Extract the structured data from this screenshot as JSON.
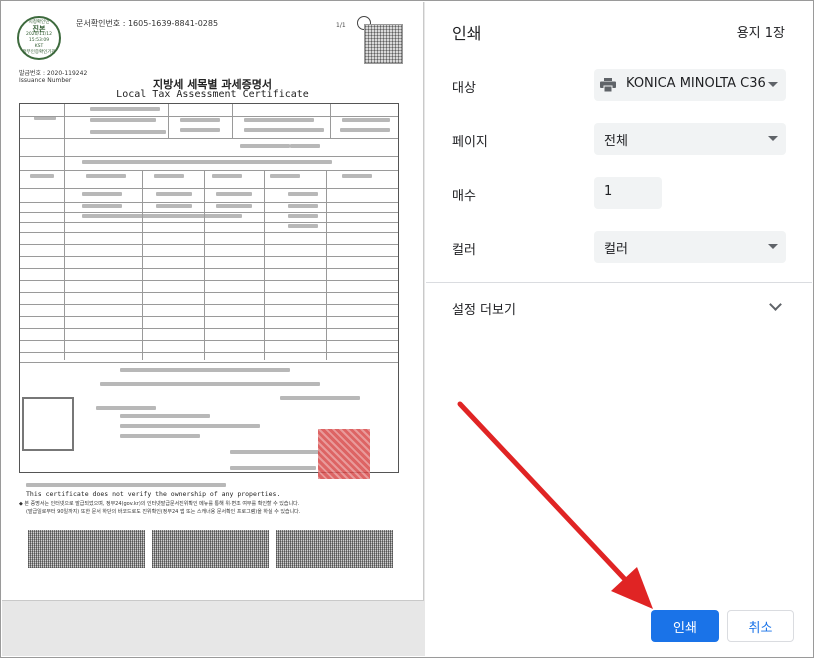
{
  "preview": {
    "seal": [
      "시청확인민",
      "진본",
      "2020/11/12",
      "15:53:09",
      "KST",
      "정부인증확인기관"
    ],
    "doc_confirm_label": "문서확인번호 :",
    "doc_confirm_number": "1605-1639-8841-0285",
    "page_indicator": "1/1",
    "issue_number": "발급번호 : 2020-119242",
    "issue_number_en": "Issuance Number",
    "title_ko": "지방세 세목별 과세증명서",
    "title_en": "Local Tax Assessment Certificate",
    "notice_en": "This certificate does not verify the ownership of any properties.",
    "footnote1": "◆ 본 증명서는 인터넷으로 발급되었으며, 정부24(gov.kr)의 인터넷발급문서진위확인 메뉴를 통해 위·변조 여부를 확인할 수 있습니다.",
    "footnote2": "(발급일로부터 90일까지) 또한 문서 하단의 바코드로도 진위확인(정부24 앱 또는 스캐너용 문서확인 프로그램)을 하실 수 있습니다."
  },
  "panel": {
    "title": "인쇄",
    "sheet_count": "용지 1장",
    "destination_label": "대상",
    "destination_value": "KONICA MINOLTA C36",
    "pages_label": "페이지",
    "pages_value": "전체",
    "copies_label": "매수",
    "copies_value": "1",
    "color_label": "컬러",
    "color_value": "컬러",
    "more_settings": "설정 더보기",
    "print_button": "인쇄",
    "cancel_button": "취소"
  },
  "colors": {
    "accent": "#1a73e8",
    "annotation_arrow": "#e02424"
  }
}
